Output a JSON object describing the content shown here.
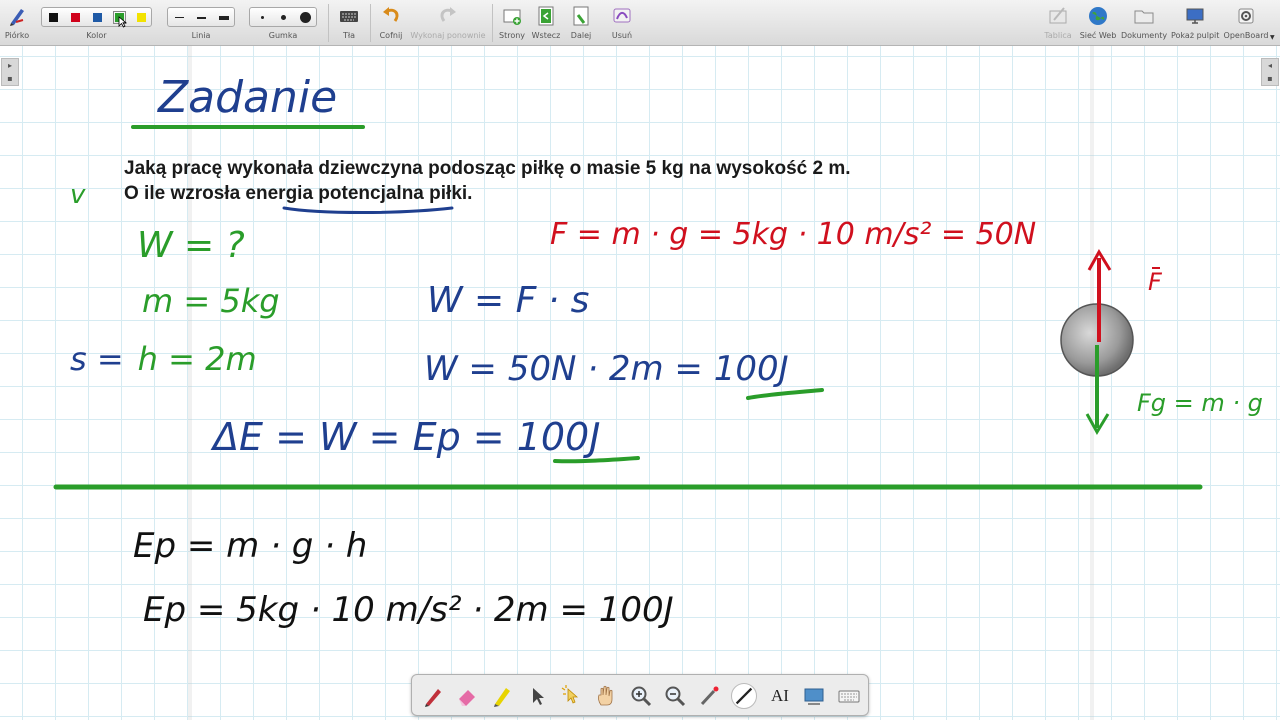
{
  "toolbar": {
    "pen": {
      "label": "Piórko",
      "icon": "pen-icon"
    },
    "color": {
      "label": "Kolor",
      "swatches": [
        "#111111",
        "#d0021b",
        "#1f5aa6",
        "#2a9d2a",
        "#f2e200"
      ]
    },
    "line": {
      "label": "Linia"
    },
    "eraser": {
      "label": "Gumka"
    },
    "backgrounds": {
      "label": "Tła",
      "icon": "keyboard-icon"
    },
    "undo": {
      "label": "Cofnij",
      "icon": "undo-icon"
    },
    "redo": {
      "label": "Wykonaj ponownie",
      "icon": "redo-icon"
    },
    "pages": {
      "label": "Strony",
      "icon": "add-page-icon"
    },
    "previous": {
      "label": "Wstecz",
      "icon": "previous-page-icon"
    },
    "next": {
      "label": "Dalej",
      "icon": "next-page-icon"
    },
    "delete": {
      "label": "Usuń",
      "icon": "delete-icon"
    },
    "board": {
      "label": "Tablica",
      "icon": "board-icon"
    },
    "web": {
      "label": "Sieć Web",
      "icon": "globe-icon"
    },
    "documents": {
      "label": "Dokumenty",
      "icon": "folder-icon"
    },
    "desktop": {
      "label": "Pokaż pulpit",
      "icon": "monitor-icon"
    },
    "openboard": {
      "label": "OpenBoard",
      "icon": "gear-icon"
    }
  },
  "board": {
    "heading": "Zadanie",
    "task_line1": "Jaką pracę wykonała dziewczyna podosząc piłkę o masie 5 kg na wysokość 2 m.",
    "task_line2": "O ile wzrosła energia potencjalna piłki.",
    "checkmark": "v",
    "unknown_w": "W = ?",
    "given_m": "m = 5kg",
    "given_s": "s = h = 2m",
    "force_eq": "F = m · g = 5kg · 10 m/s² = 50N",
    "work_formula": "W = F · s",
    "work_calc": "W = 50N · 2m = 100J",
    "energy_eq": "ΔE = W = Ep = 100J",
    "ep_formula": "Ep = m · g · h",
    "ep_calc": "Ep = 5kg · 10 m/s² · 2m = 100J",
    "arrow_up_label": "F",
    "arrow_down_label": "Fg = m · g",
    "colors": {
      "green": "#2a9d2a",
      "blue": "#1f3f8f",
      "red": "#d0101e",
      "black": "#111111"
    }
  },
  "palette": {
    "tools": [
      "pen-icon",
      "eraser-icon",
      "marker-icon",
      "selector-icon",
      "interact-icon",
      "hand-icon",
      "zoom-in-icon",
      "zoom-out-icon",
      "laser-pointer-icon",
      "line-icon",
      "text-icon",
      "capture-icon",
      "keyboard-icon"
    ],
    "active_tool": "line-icon",
    "text_tool_glyph": "AI"
  }
}
